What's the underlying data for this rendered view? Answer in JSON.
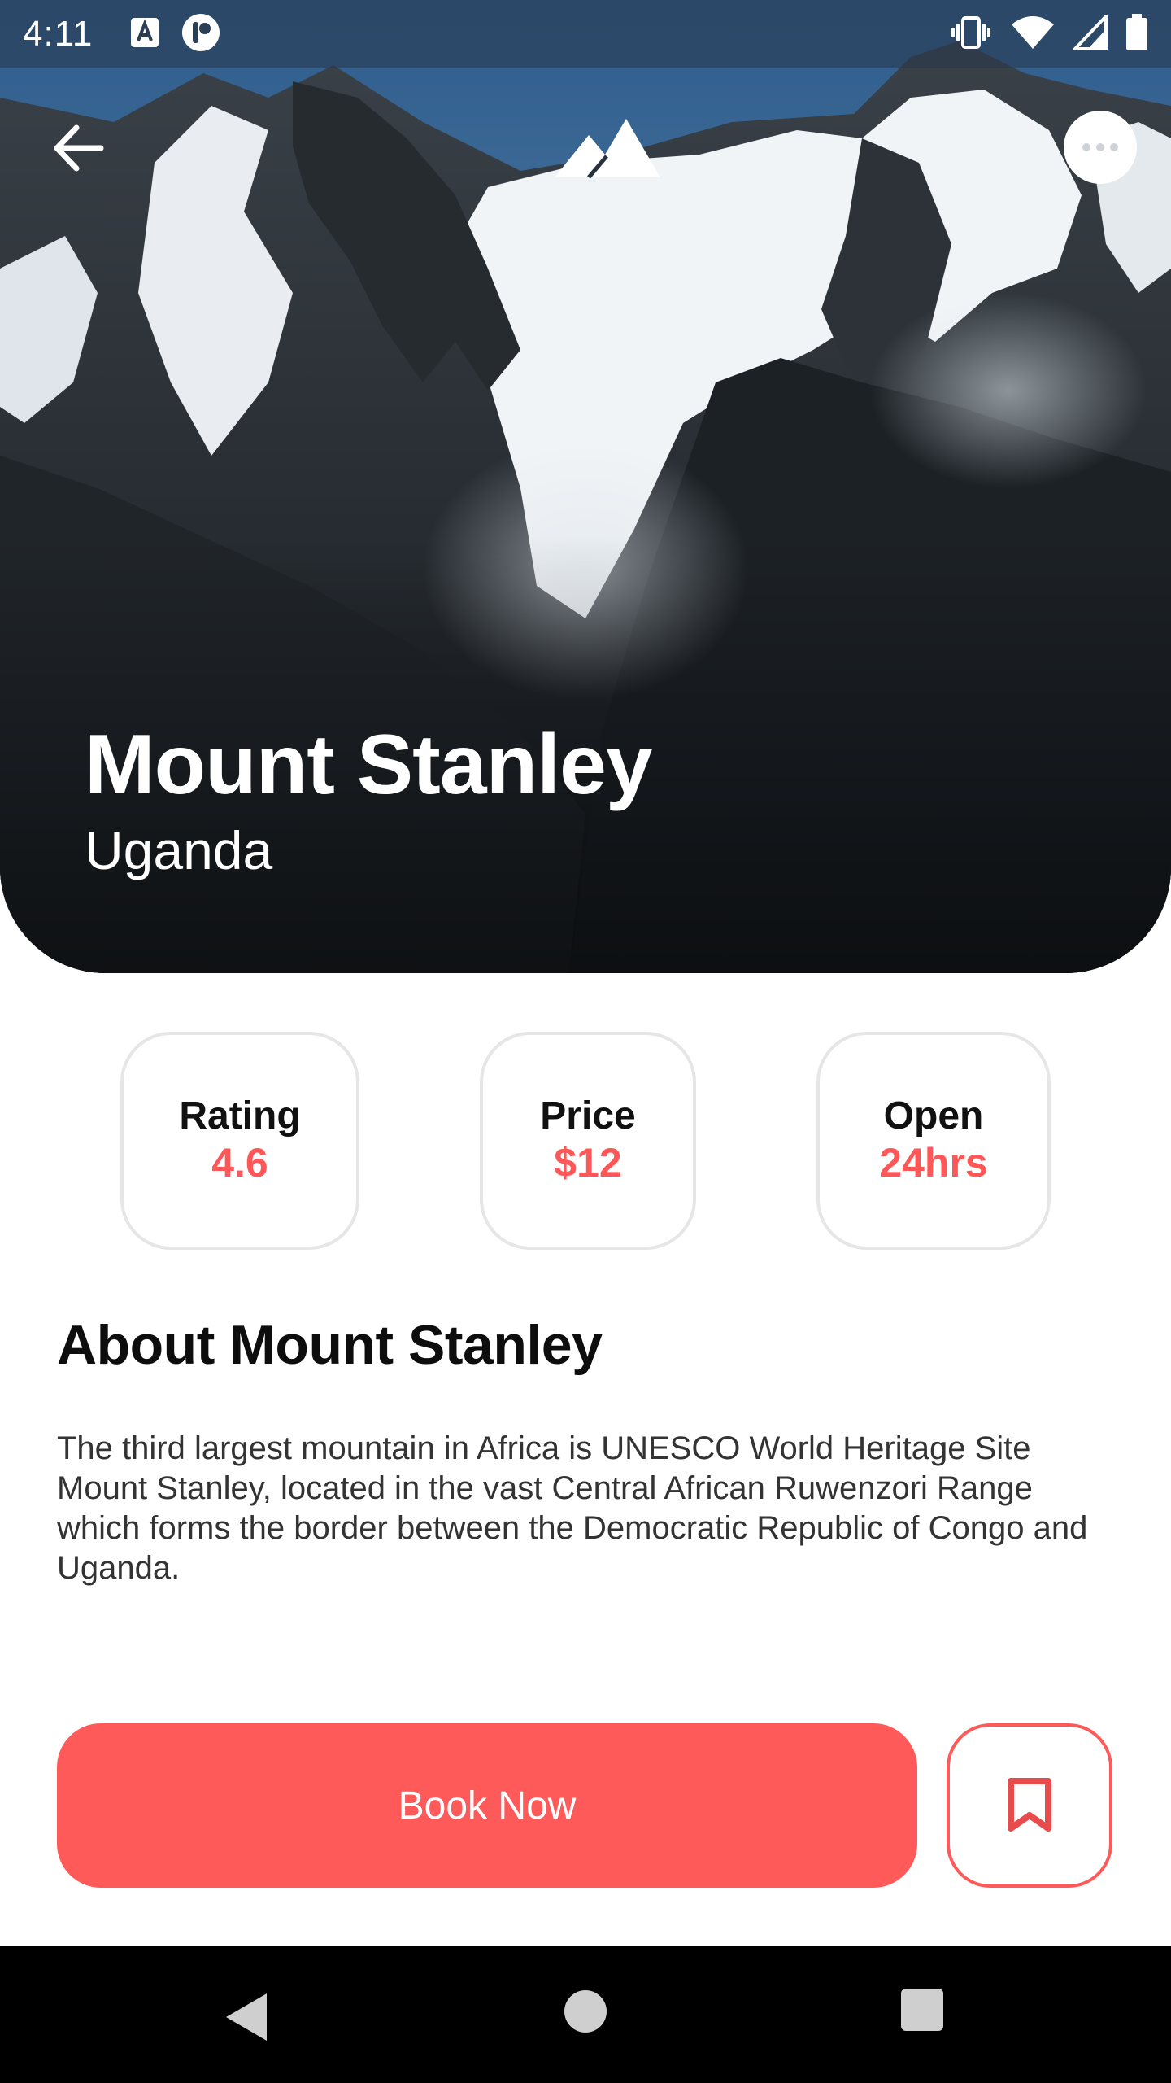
{
  "status_bar": {
    "time": "4:11",
    "icons": [
      "a-badge-icon",
      "circle-p-icon",
      "vibrate-icon",
      "wifi-icon",
      "signal-icon",
      "battery-icon"
    ]
  },
  "header": {
    "back_icon": "arrow-left-icon",
    "logo_icon": "mountain-logo-icon",
    "more_icon": "more-horizontal-icon"
  },
  "hero": {
    "title": "Mount Stanley",
    "subtitle": "Uganda"
  },
  "stats": [
    {
      "label": "Rating",
      "value": "4.6"
    },
    {
      "label": "Price",
      "value": "$12"
    },
    {
      "label": "Open",
      "value": "24hrs"
    }
  ],
  "about": {
    "title": "About Mount Stanley",
    "body": "The third largest mountain in Africa is UNESCO World Heritage Site Mount Stanley, located in the vast Central African Ruwenzori Range which forms the border between the Democratic Republic of Congo and Uganda."
  },
  "actions": {
    "book_label": "Book Now",
    "bookmark_icon": "bookmark-icon"
  },
  "colors": {
    "accent": "#ff5a5a",
    "stat_value": "#ff5757",
    "card_border": "#e6e6e6"
  }
}
